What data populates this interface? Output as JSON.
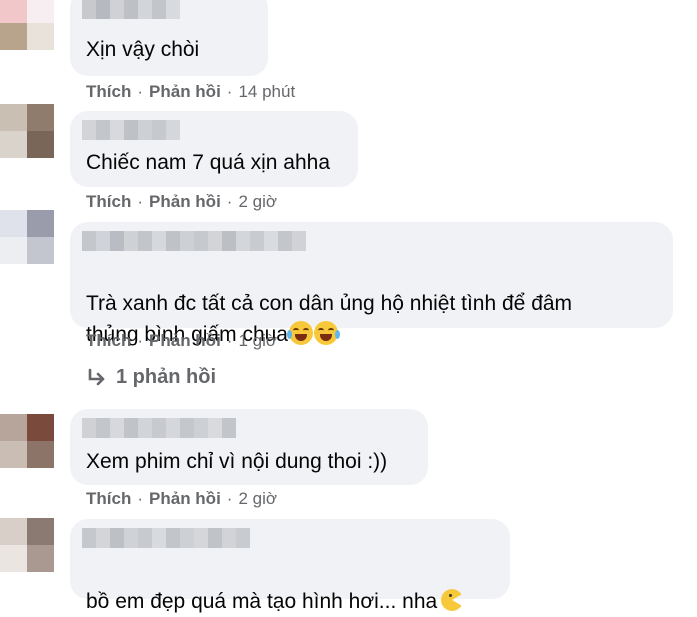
{
  "actions": {
    "like": "Thích",
    "reply": "Phản hồi",
    "separator": "·"
  },
  "comments": [
    {
      "text": "Xịn vậy chòi",
      "time": "14 phút"
    },
    {
      "text": "Chiếc nam 7 quá xịn ahha",
      "time": "2 giờ"
    },
    {
      "text": "Trà xanh đc tất cả con dân ủng hộ nhiệt tình để đâm\nthủng bình giấm chua",
      "emoji": "laughing-tears-emoji",
      "time": "1 giờ"
    },
    {
      "text": "Xem phim chỉ vì nội dung thoi :))",
      "time": "2 giờ"
    },
    {
      "text": "bồ em đẹp quá mà tạo hình hơi... nha",
      "emoji": "pacman-emoji"
    }
  ],
  "reply_link": {
    "label": "1 phản hồi",
    "icon": "reply-arrow-icon"
  },
  "colors": {
    "bubble": "#f0f2f5",
    "meta": "#65676b",
    "text": "#050505"
  }
}
